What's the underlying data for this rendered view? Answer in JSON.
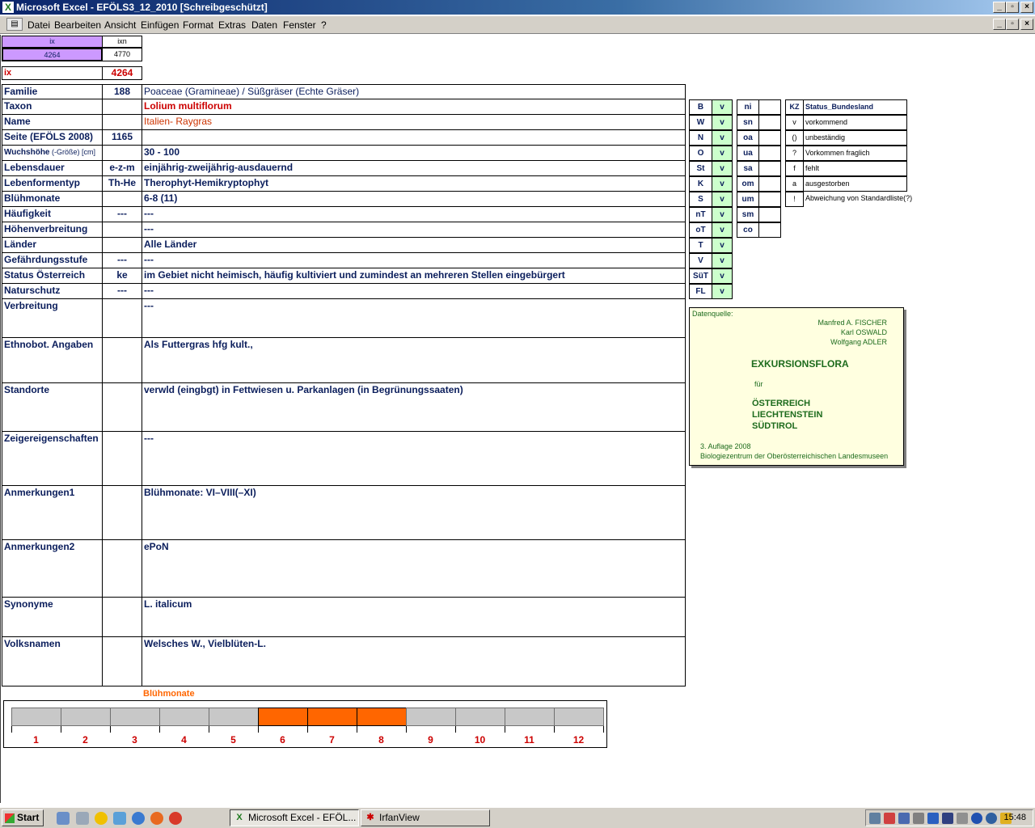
{
  "window": {
    "title": "Microsoft Excel - EFÖLS3_12_2010  [Schreibgeschützt]",
    "app_icon": "excel-x-icon"
  },
  "menu": [
    "Datei",
    "Bearbeiten",
    "Ansicht",
    "Einfügen",
    "Format",
    "Extras",
    "Daten",
    "Fenster",
    "?"
  ],
  "index": {
    "ix_header": "ix",
    "ix_value": "4264",
    "ixn_header": "ixn",
    "ixn_value": "4770",
    "ix_label": "ix",
    "ix_big": "4264",
    "header_color": "#cc99ff"
  },
  "fields": [
    {
      "label": "Familie",
      "mid": "188",
      "value": "Poaceae (Gramineae)  /  Süßgräser (Echte Gräser)"
    },
    {
      "label": "Taxon",
      "mid": "",
      "value": "Lolium multiflorum"
    },
    {
      "label": "Name",
      "mid": "",
      "value": "Italien- Raygras"
    },
    {
      "label": "Seite (EFÖLS 2008)",
      "mid": "1165",
      "value": ""
    },
    {
      "label": "Wuchshöhe",
      "label_suffix": " (-Größe) [cm]",
      "mid": "",
      "value": " 30 - 100"
    },
    {
      "label": "Lebensdauer",
      "mid": "e-z-m",
      "value": "einjährig-zweijährig-ausdauernd"
    },
    {
      "label": "Lebenformentyp",
      "mid": "Th-He",
      "value": "Therophyt-Hemikryptophyt"
    },
    {
      "label": "Blühmonate",
      "mid": "",
      "value": " 6-8 (11)"
    },
    {
      "label": "Häufigkeit",
      "mid": "---",
      "value": " ---"
    },
    {
      "label": "Höhenverbreitung",
      "mid": "",
      "value": " ---"
    },
    {
      "label": "Länder",
      "mid": "",
      "value": "Alle Länder"
    },
    {
      "label": "Gefährdungsstufe",
      "mid": "---",
      "value": "  ---"
    },
    {
      "label": "Status Österreich",
      "mid": "ke",
      "value": "im Gebiet nicht heimisch, häufig kultiviert und zumindest an mehreren Stellen eingebürgert"
    },
    {
      "label": "Naturschutz",
      "mid": "---",
      "value": " ---"
    },
    {
      "label": "Verbreitung",
      "mid": "",
      "value": " ---"
    },
    {
      "label": "Ethnobot. Angaben",
      "mid": "",
      "value": "Als Futtergras hfg kult.,"
    },
    {
      "label": "Standorte",
      "mid": "",
      "value": "verwld (eingbgt) in Fettwiesen u. Parkanlagen (in Begrünungssaaten)"
    },
    {
      "label": "Zeigereigenschaften",
      "mid": "",
      "value": "---"
    },
    {
      "label": "Anmerkungen1",
      "mid": "",
      "value": "Blühmonate: VI–VIII(–XI)"
    },
    {
      "label": "Anmerkungen2",
      "mid": "",
      "value": "ePoN"
    },
    {
      "label": "Synonyme",
      "mid": "",
      "value": "L. italicum"
    },
    {
      "label": "Volksnamen",
      "mid": "",
      "value": "Welsches W., Vielblüten-L."
    }
  ],
  "colors": {
    "taxon_red": "#cc0000",
    "name_red": "#cc3300",
    "label_blue": "#0b1e5c",
    "status_green": "#ccffcc",
    "bloom_orange": "#ff6600"
  },
  "status_regions": [
    {
      "code": "B",
      "val": "v"
    },
    {
      "code": "W",
      "val": "v"
    },
    {
      "code": "N",
      "val": "v"
    },
    {
      "code": "O",
      "val": "v"
    },
    {
      "code": "St",
      "val": "v"
    },
    {
      "code": "K",
      "val": "v"
    },
    {
      "code": "S",
      "val": "v"
    },
    {
      "code": "nT",
      "val": "v"
    },
    {
      "code": "oT",
      "val": "v"
    },
    {
      "code": "T",
      "val": "v"
    },
    {
      "code": "V",
      "val": "v"
    },
    {
      "code": "SüT",
      "val": "v"
    },
    {
      "code": "FL",
      "val": "v"
    }
  ],
  "status_neighbors": [
    "ni",
    "sn",
    "oa",
    "ua",
    "sa",
    "om",
    "um",
    "sm",
    "co"
  ],
  "kz_legend": {
    "header_code": "KZ",
    "header_text": "Status_Bundesland",
    "items": [
      {
        "code": "v",
        "text": "vorkommend"
      },
      {
        "code": "()",
        "text": "unbeständig"
      },
      {
        "code": "?",
        "text": "Vorkommen fraglich"
      },
      {
        "code": "f",
        "text": "fehlt"
      },
      {
        "code": "a",
        "text": "ausgestorben"
      },
      {
        "code": "!",
        "text": "Abweichung von Standardliste(?)"
      }
    ]
  },
  "datenquelle": {
    "label": "Datenquelle:",
    "authors": [
      "Manfred A. FISCHER",
      "Karl OSWALD",
      "Wolfgang ADLER"
    ],
    "title": "EXKURSIONSFLORA",
    "fuer": "für",
    "countries": [
      "ÖSTERREICH",
      "LIECHTENSTEIN",
      "SÜDTIROL"
    ],
    "edition": "3. Auflage 2008",
    "publisher": "Biologiezentrum der Oberösterreichischen Landesmuseen"
  },
  "bloom_chart": {
    "title": "Blühmonate",
    "months": [
      "1",
      "2",
      "3",
      "4",
      "5",
      "6",
      "7",
      "8",
      "9",
      "10",
      "11",
      "12"
    ],
    "active": [
      false,
      false,
      false,
      false,
      false,
      true,
      true,
      true,
      false,
      false,
      false,
      false
    ]
  },
  "taskbar": {
    "start": "Start",
    "items": [
      {
        "label": "Microsoft Excel - EFÖL...",
        "icon": "excel-x-icon",
        "active": true
      },
      {
        "label": "IrfanView",
        "icon": "irfanview-icon",
        "active": false
      }
    ],
    "clock": "15:48"
  }
}
